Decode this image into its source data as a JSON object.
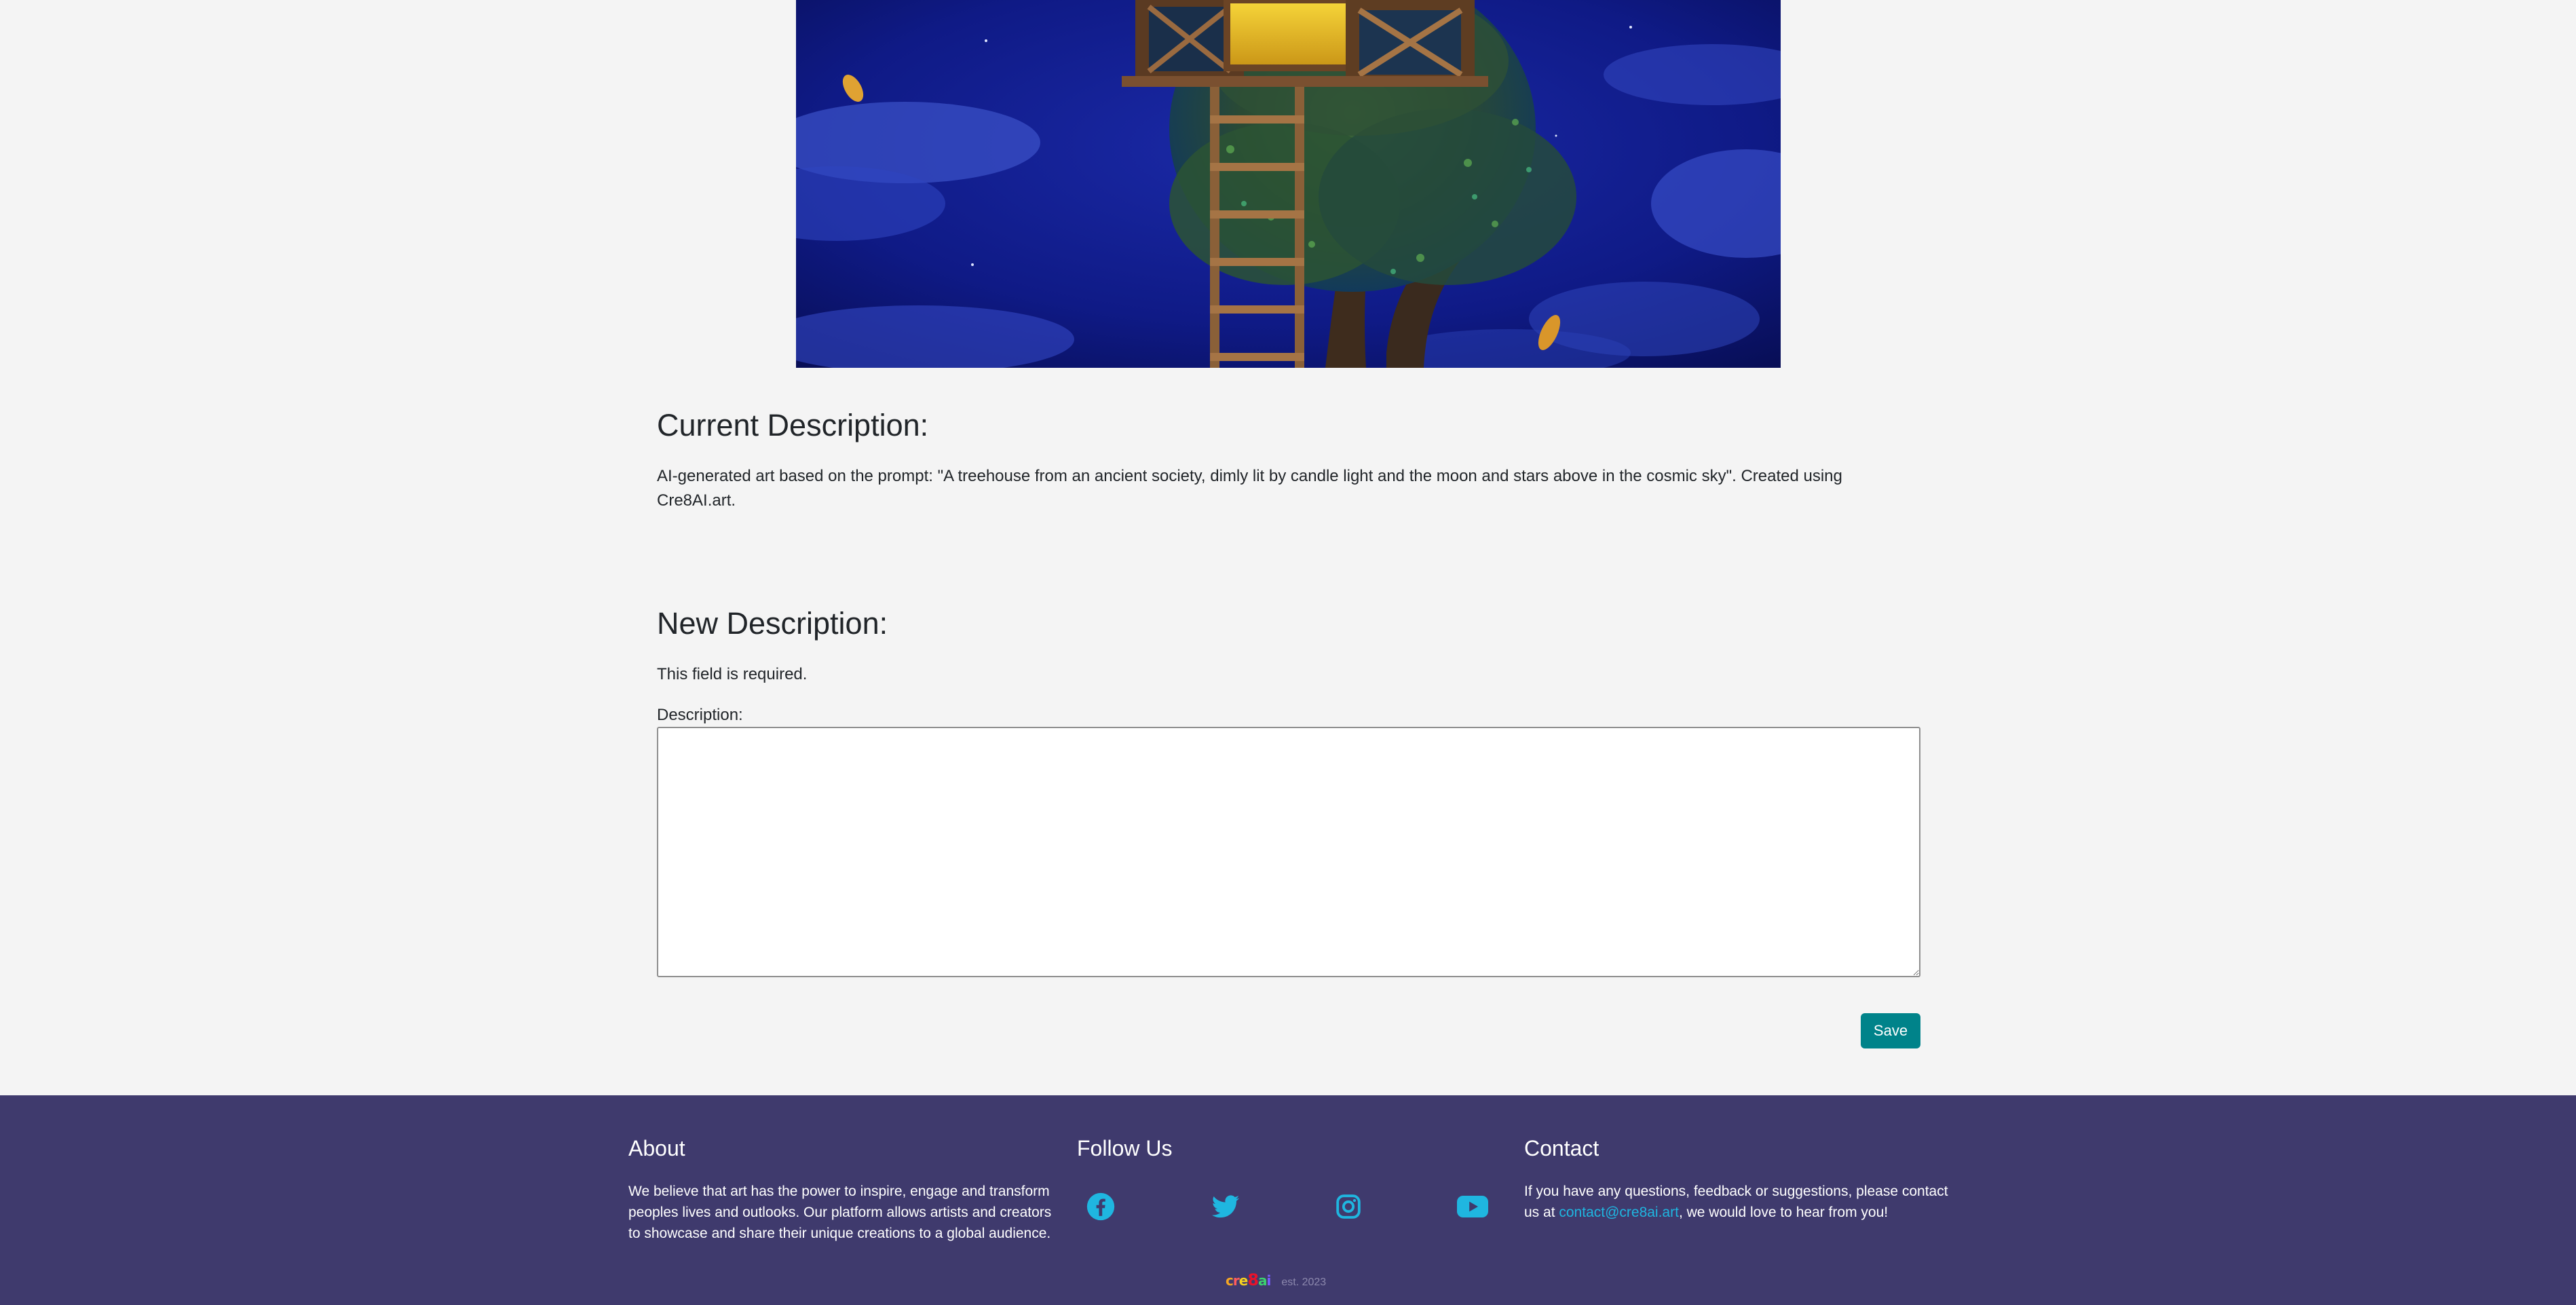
{
  "current": {
    "title": "Current Description:",
    "text": "AI-generated art based on the prompt: \"A treehouse from an ancient society, dimly lit by candle light and the moon and stars above in the cosmic sky\". Created using Cre8AI.art."
  },
  "new": {
    "title": "New Description:",
    "required_message": "This field is required.",
    "label": "Description:",
    "value": "",
    "save_label": "Save"
  },
  "footer": {
    "about_title": "About",
    "about_text": "We believe that art has the power to inspire, engage and transform peoples lives and outlooks. Our platform allows artists and creators to showcase and share their unique creations to a global audience.",
    "follow_title": "Follow Us",
    "social_icons": [
      "facebook-icon",
      "twitter-icon",
      "instagram-icon",
      "youtube-icon"
    ],
    "contact_title": "Contact",
    "contact_text_before": "If you have any questions, feedback or suggestions, please contact us at ",
    "contact_email": "contact@cre8ai.art",
    "contact_text_after": ", we would love to hear from you!",
    "brand_logo_text": "cre8ai.art",
    "brand_est": "est. 2023"
  },
  "colors": {
    "page_bg": "#f4f4f4",
    "footer_bg": "#3f3a6d",
    "accent": "#00838a",
    "icon": "#1fb6e0"
  }
}
